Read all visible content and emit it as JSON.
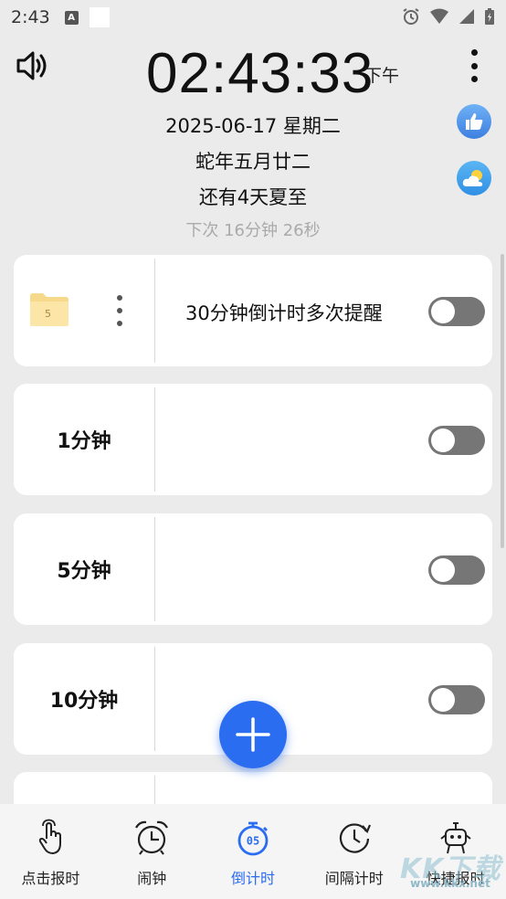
{
  "status_bar": {
    "time": "2:43",
    "a_badge": "A"
  },
  "header": {
    "clock": "02:43:33",
    "ampm": "下午",
    "date": "2025-06-17 星期二",
    "lunar": "蛇年五月廿二",
    "solar_term": "还有4天夏至",
    "next": "下次  16分钟 26秒"
  },
  "timers": [
    {
      "label": "",
      "title": "30分钟倒计时多次提醒",
      "folder_count": "5",
      "enabled": false
    },
    {
      "label": "1分钟",
      "title": "",
      "enabled": false
    },
    {
      "label": "5分钟",
      "title": "",
      "enabled": false
    },
    {
      "label": "10分钟",
      "title": "",
      "enabled": false
    },
    {
      "label": "",
      "title": "",
      "enabled": false
    }
  ],
  "bottom_nav": [
    {
      "label": "点击报时",
      "icon": "tap-hand-icon",
      "active": false
    },
    {
      "label": "闹钟",
      "icon": "alarm-clock-icon",
      "active": false
    },
    {
      "label": "倒计时",
      "icon": "stopwatch-icon",
      "active": true,
      "badge": "05"
    },
    {
      "label": "间隔计时",
      "icon": "interval-clock-icon",
      "active": false
    },
    {
      "label": "快捷报时",
      "icon": "shortcut-robot-icon",
      "active": false
    }
  ],
  "watermark": {
    "brand": "KK下载",
    "url": "www.kkx.net"
  },
  "colors": {
    "accent": "#2b6df0",
    "toggle_off": "#767676",
    "background": "#ebebeb"
  }
}
